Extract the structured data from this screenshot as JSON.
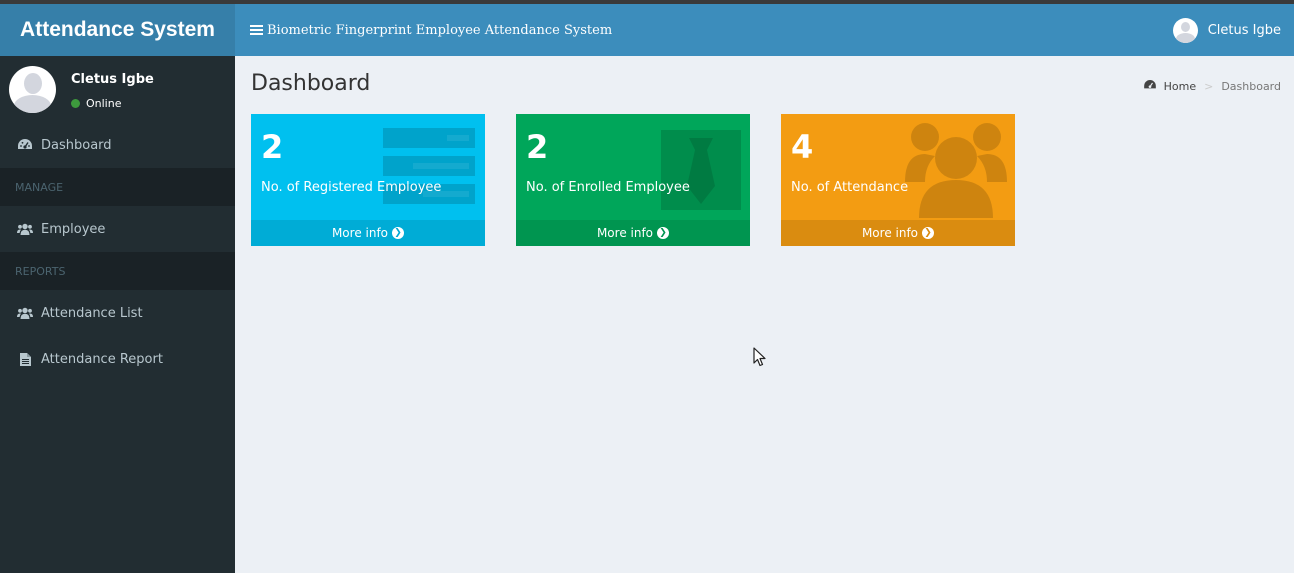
{
  "header": {
    "logo_text": "Attendance System",
    "nav_title": "Biometric Fingerprint Employee Attendance System",
    "user_name": "Cletus Igbe"
  },
  "sidebar": {
    "user": {
      "name": "Cletus Igbe",
      "status": "Online"
    },
    "dashboard_label": "Dashboard",
    "manage_header": "MANAGE",
    "employee_label": "Employee",
    "reports_header": "REPORTS",
    "attendance_list_label": "Attendance List",
    "attendance_report_label": "Attendance Report"
  },
  "main": {
    "page_title": "Dashboard",
    "breadcrumb": {
      "home": "Home",
      "current": "Dashboard"
    }
  },
  "boxes": [
    {
      "count": "2",
      "label": "No. of Registered Employee",
      "more": "More info",
      "color": "#00c0ef",
      "icon": "list-icon"
    },
    {
      "count": "2",
      "label": "No. of Enrolled Employee",
      "more": "More info",
      "color": "#00a65a",
      "icon": "tie-icon"
    },
    {
      "count": "4",
      "label": "No. of Attendance",
      "more": "More info",
      "color": "#f39c12",
      "icon": "users-icon"
    }
  ],
  "colors": {
    "header_blue": "#3c8dbc",
    "logo_blue": "#367fa9",
    "sidebar_dark": "#222d32",
    "content_bg": "#ecf0f5"
  }
}
